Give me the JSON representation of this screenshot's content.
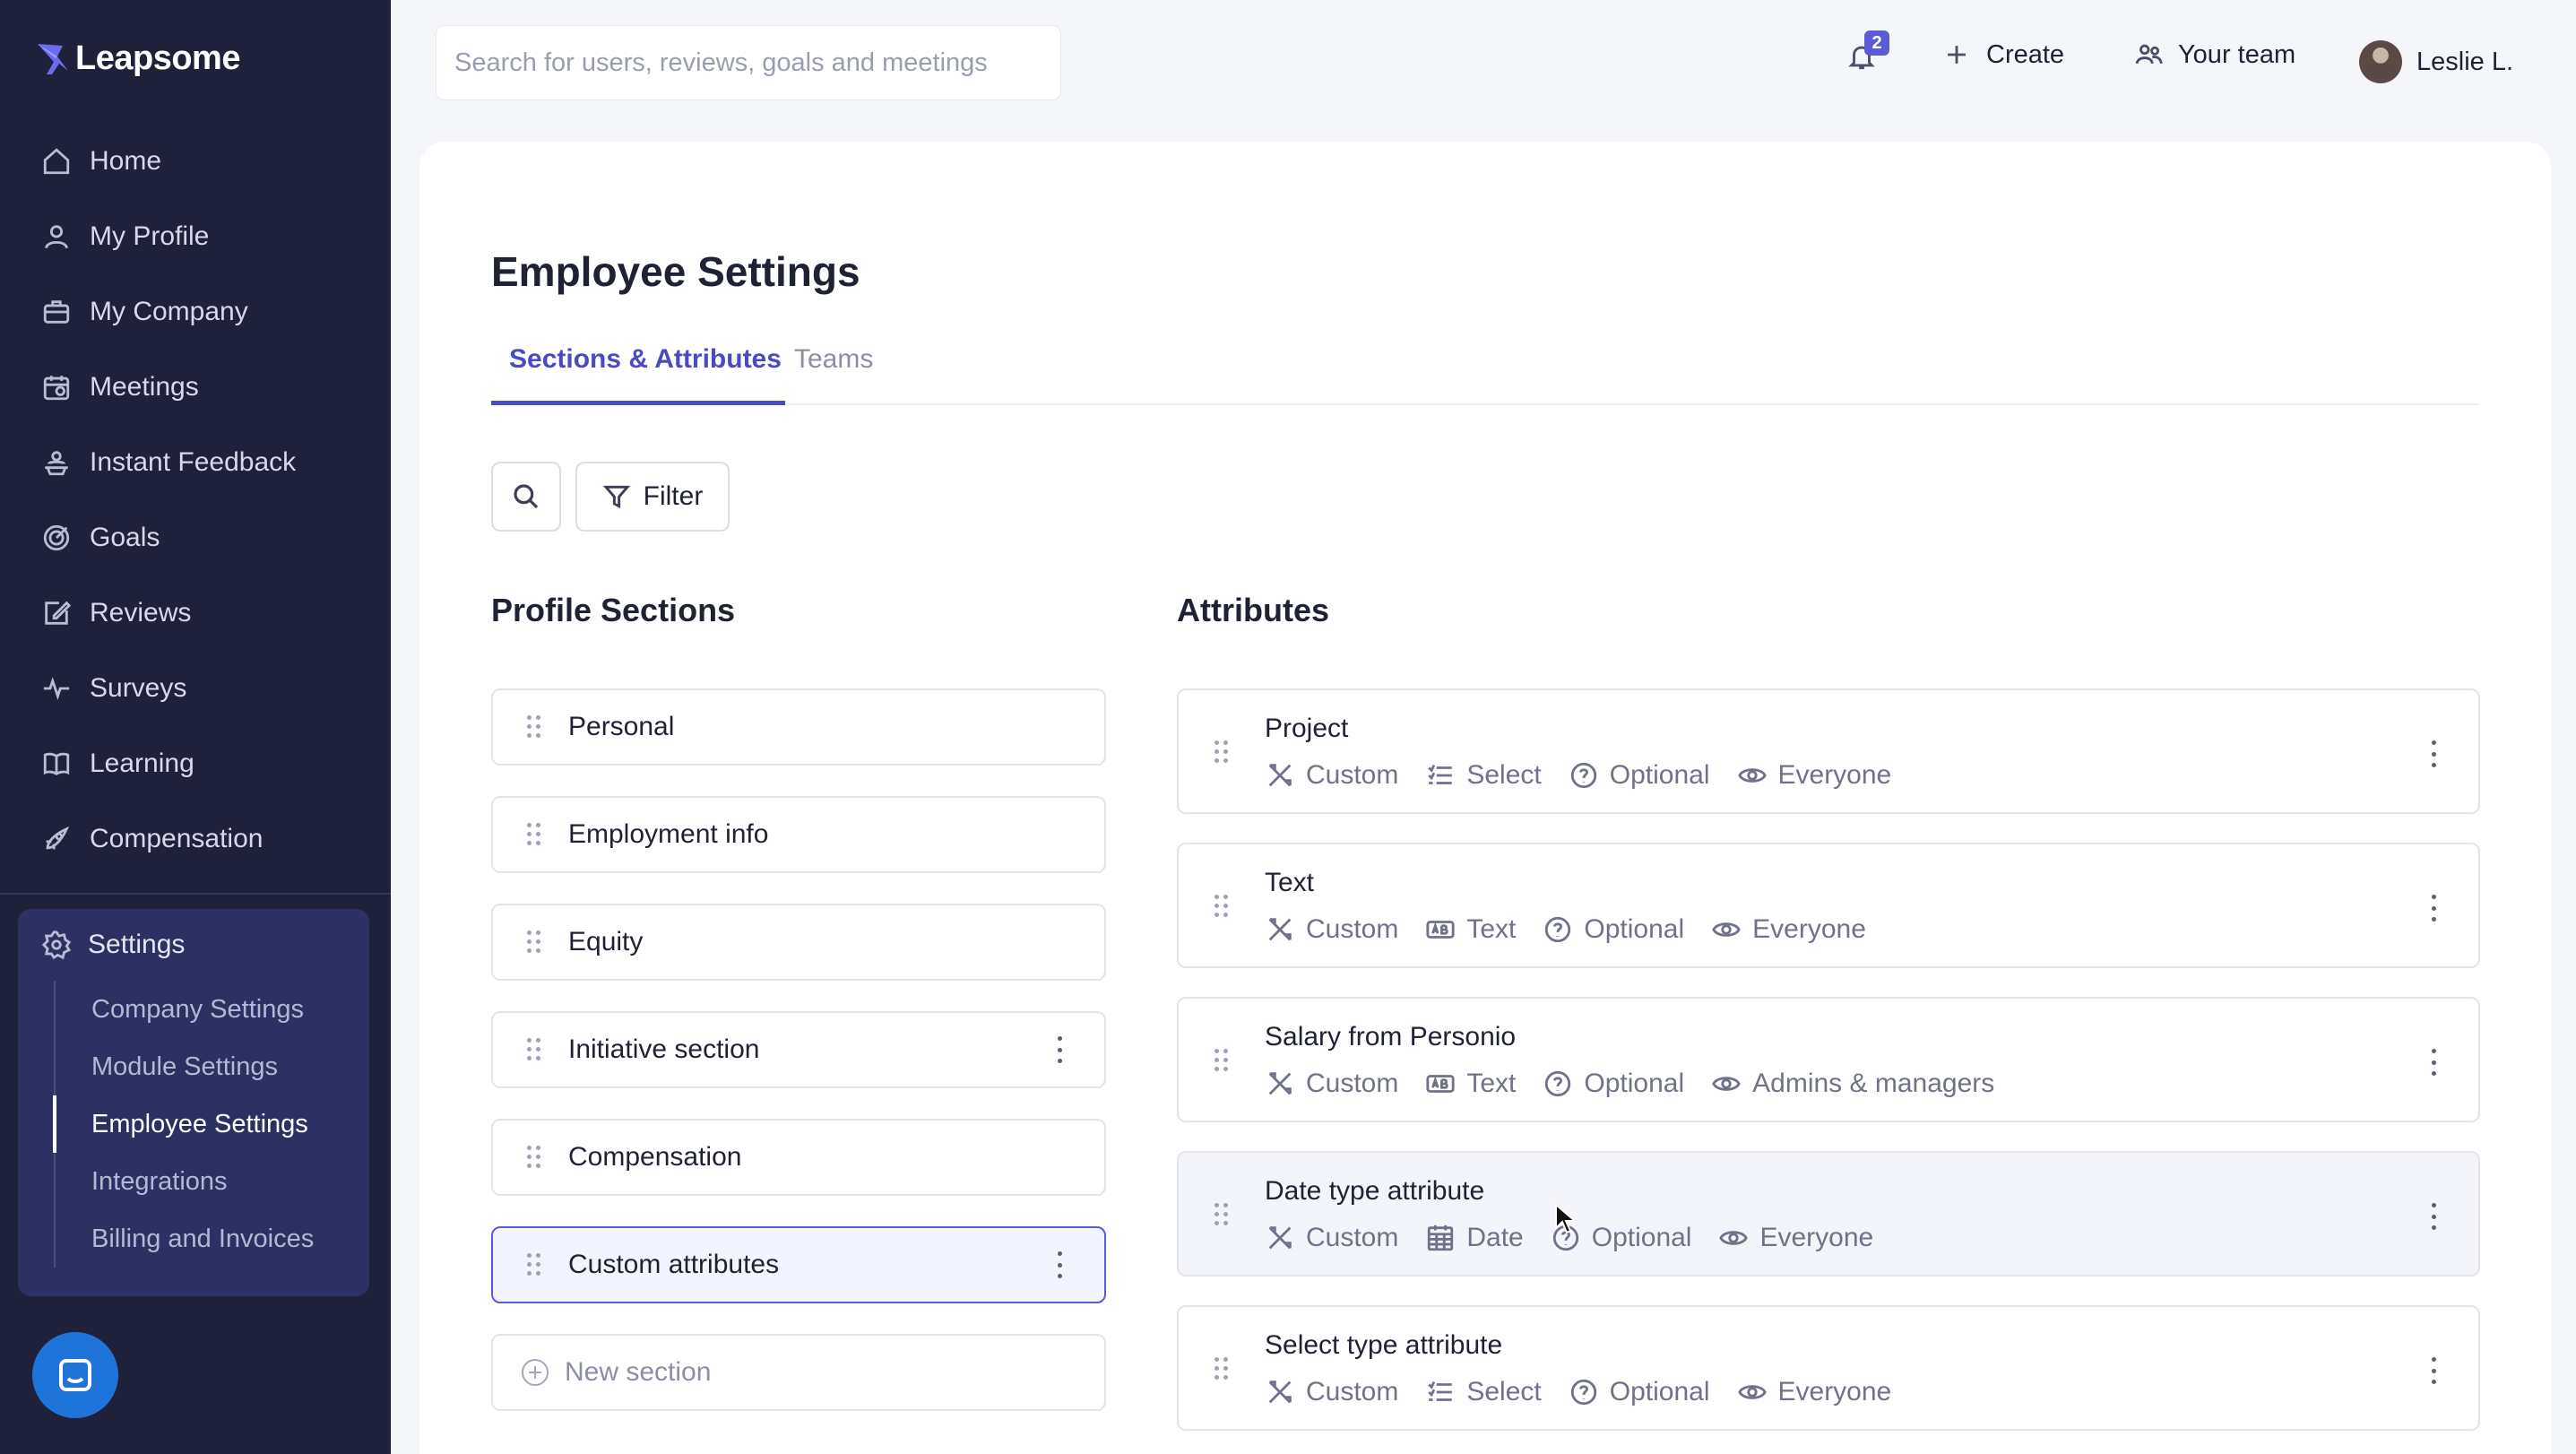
{
  "brand": {
    "name": "Leapsome"
  },
  "sidebar": {
    "items": [
      {
        "label": "Home",
        "icon": "home-icon"
      },
      {
        "label": "My Profile",
        "icon": "user-icon"
      },
      {
        "label": "My Company",
        "icon": "briefcase-icon"
      },
      {
        "label": "Meetings",
        "icon": "calendar-icon"
      },
      {
        "label": "Instant Feedback",
        "icon": "feedback-icon"
      },
      {
        "label": "Goals",
        "icon": "target-icon"
      },
      {
        "label": "Reviews",
        "icon": "edit-icon"
      },
      {
        "label": "Surveys",
        "icon": "pulse-icon"
      },
      {
        "label": "Learning",
        "icon": "book-icon"
      },
      {
        "label": "Compensation",
        "icon": "rocket-icon"
      }
    ],
    "settings": {
      "label": "Settings",
      "icon": "gear-icon",
      "sub_items": [
        {
          "label": "Company Settings",
          "active": false
        },
        {
          "label": "Module Settings",
          "active": false
        },
        {
          "label": "Employee Settings",
          "active": true
        },
        {
          "label": "Integrations",
          "active": false
        },
        {
          "label": "Billing and Invoices",
          "active": false
        }
      ]
    }
  },
  "topbar": {
    "search_placeholder": "Search for users, reviews, goals and meetings",
    "notification_count": "2",
    "create_label": "Create",
    "team_label": "Your team",
    "user_name": "Leslie L."
  },
  "page": {
    "title": "Employee Settings",
    "tabs": [
      {
        "label": "Sections & Attributes",
        "active": true
      },
      {
        "label": "Teams",
        "active": false
      }
    ],
    "filter_label": "Filter",
    "sections_title": "Profile Sections",
    "attributes_title": "Attributes",
    "sections": [
      {
        "label": "Personal",
        "has_menu": false,
        "selected": false
      },
      {
        "label": "Employment info",
        "has_menu": false,
        "selected": false
      },
      {
        "label": "Equity",
        "has_menu": false,
        "selected": false
      },
      {
        "label": "Initiative section",
        "has_menu": true,
        "selected": false
      },
      {
        "label": "Compensation",
        "has_menu": false,
        "selected": false
      },
      {
        "label": "Custom attributes",
        "has_menu": true,
        "selected": true
      }
    ],
    "new_section_label": "New section",
    "attributes": [
      {
        "name": "Project",
        "source": "Custom",
        "type": "Select",
        "type_icon": "list-icon",
        "requirement": "Optional",
        "visibility": "Everyone"
      },
      {
        "name": "Text",
        "source": "Custom",
        "type": "Text",
        "type_icon": "text-field-icon",
        "requirement": "Optional",
        "visibility": "Everyone"
      },
      {
        "name": "Salary from Personio",
        "source": "Custom",
        "type": "Text",
        "type_icon": "text-field-icon",
        "requirement": "Optional",
        "visibility": "Admins & managers"
      },
      {
        "name": "Date type attribute",
        "source": "Custom",
        "type": "Date",
        "type_icon": "calendar-grid-icon",
        "requirement": "Optional",
        "visibility": "Everyone"
      },
      {
        "name": "Select type attribute",
        "source": "Custom",
        "type": "Select",
        "type_icon": "list-icon",
        "requirement": "Optional",
        "visibility": "Everyone"
      }
    ]
  },
  "colors": {
    "sidebar_bg": "#1e2139",
    "accent": "#4a4bc4",
    "badge": "#5b5bd6",
    "chat": "#1f74d9"
  }
}
